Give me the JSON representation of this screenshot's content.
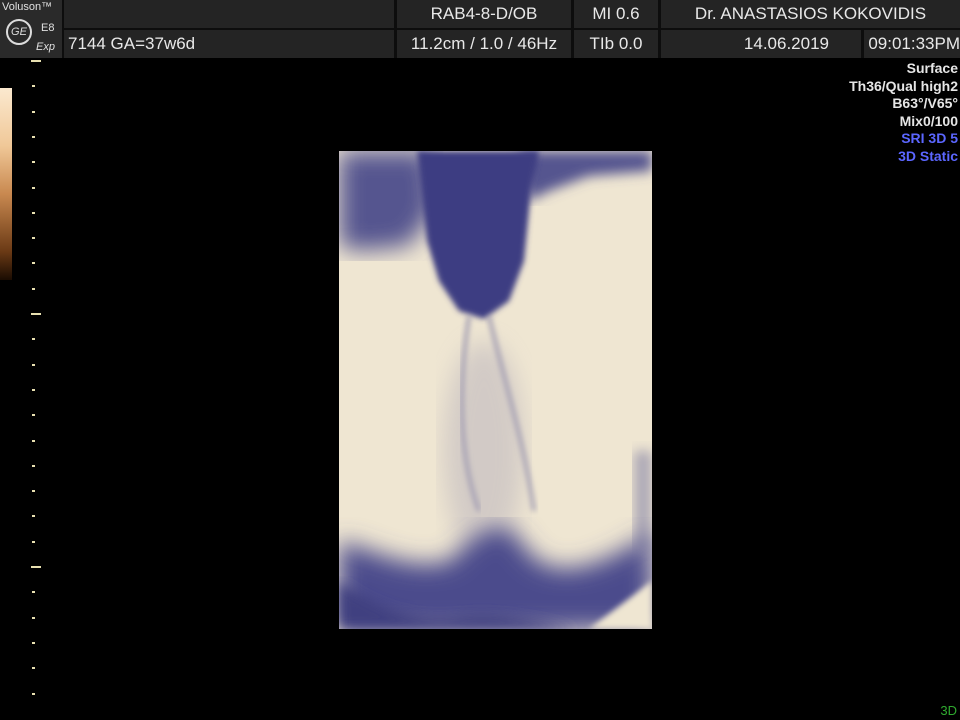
{
  "header": {
    "brand": "Voluson™",
    "logo_mark": "GE",
    "model": "E8",
    "model_sub": "Exp",
    "probe": "RAB4-8-D/OB",
    "mi": "MI  0.6",
    "doctor": "Dr. ANASTASIOS KOKOVIDIS",
    "patient_info": "7144  GA=37w6d",
    "depth_info": "11.2cm / 1.0 / 46Hz",
    "tib": "TIb  0.0",
    "date": "14.06.2019",
    "time": "09:01:33PM"
  },
  "params": {
    "line1": "Surface",
    "line2": "Th36/Qual high2",
    "line3": "B63°/V65°",
    "line4": "Mix0/100",
    "line5": "SRI 3D 5",
    "line6": "3D Static"
  },
  "mode_badge": "3D",
  "colors": {
    "header_cell": "#242424",
    "highlight_text": "#5b66ff",
    "mode_badge": "#2faa2f",
    "render_light": "#efe6d2",
    "render_dark": "#4a4a8a"
  },
  "icons": [
    "ge-logo-icon"
  ]
}
